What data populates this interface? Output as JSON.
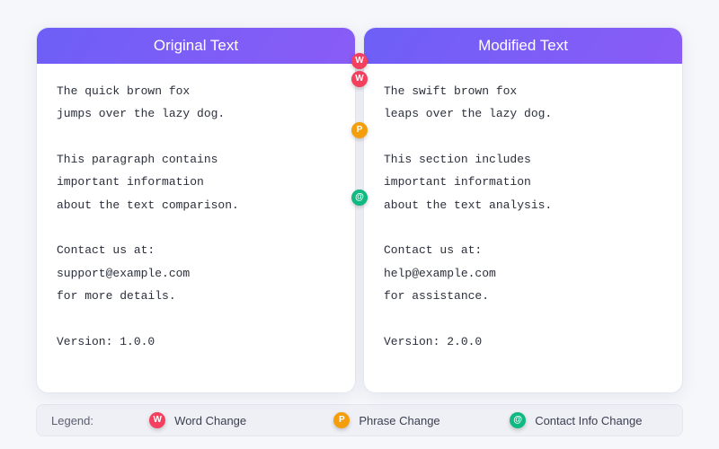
{
  "panels": {
    "original": {
      "title": "Original Text",
      "text": "The quick brown fox\njumps over the lazy dog.\n\nThis paragraph contains\nimportant information\nabout the text comparison.\n\nContact us at:\nsupport@example.com\nfor more details.\n\nVersion: 1.0.0"
    },
    "modified": {
      "title": "Modified Text",
      "text": "The swift brown fox\nleaps over the lazy dog.\n\nThis section includes\nimportant information\nabout the text analysis.\n\nContact us at:\nhelp@example.com\nfor assistance.\n\nVersion: 2.0.0"
    }
  },
  "markers": [
    {
      "kind": "word",
      "letter": "W",
      "topPx": 38
    },
    {
      "kind": "word",
      "letter": "W",
      "topPx": 58
    },
    {
      "kind": "phrase",
      "letter": "P",
      "topPx": 115
    },
    {
      "kind": "contact",
      "letter": "@",
      "topPx": 190
    }
  ],
  "legend": {
    "label": "Legend:",
    "items": [
      {
        "kind": "word",
        "letter": "W",
        "text": "Word Change"
      },
      {
        "kind": "phrase",
        "letter": "P",
        "text": "Phrase Change"
      },
      {
        "kind": "contact",
        "letter": "@",
        "text": "Contact Info Change"
      }
    ]
  }
}
